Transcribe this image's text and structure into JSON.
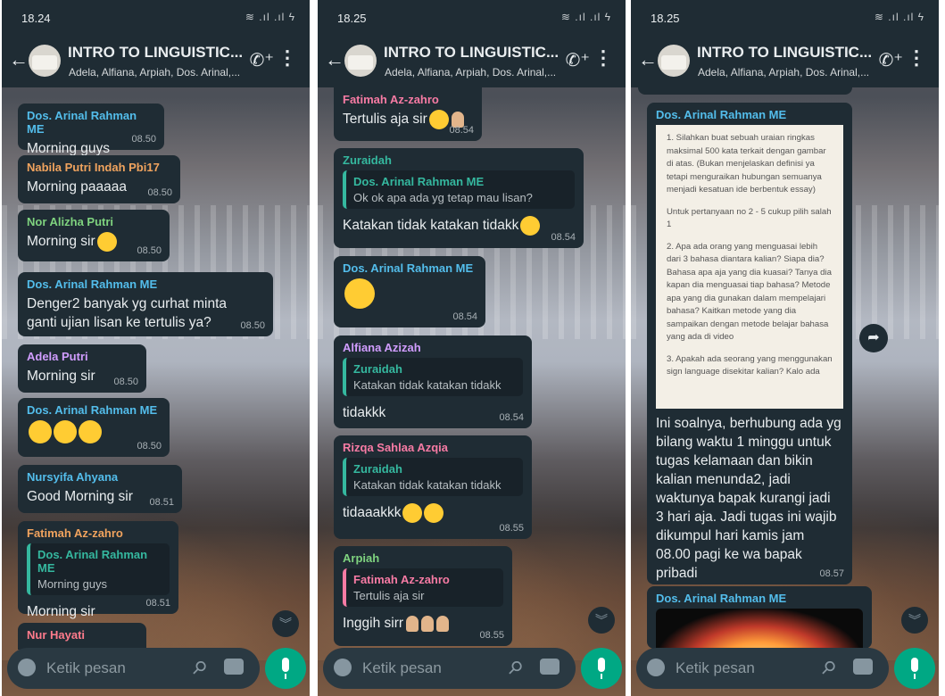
{
  "chat": {
    "title": "INTRO TO LINGUISTIC...",
    "members": "Adela, Alfiana, Arpiah, Dos. Arinal,...",
    "input_placeholder": "Ketik pesan"
  },
  "colors": {
    "header_bg": "#1f2c34",
    "bubble_bg": "#1f2c34",
    "accent": "#00a884"
  },
  "icons": [
    "back-arrow-icon",
    "group-avatar",
    "add-call-icon",
    "more-vert-icon",
    "emoji-icon",
    "attach-icon",
    "camera-icon",
    "mic-icon",
    "scroll-down-icon",
    "forward-icon"
  ],
  "screens": [
    {
      "status_time": "18.24",
      "messages": [
        {
          "sender": "Dos. Arinal Rahman ME",
          "text": "Morning guys",
          "time": "08.50"
        },
        {
          "sender": "Nabila Putri Indah Pbi17",
          "text": "Morning paaaaa",
          "time": "08.50"
        },
        {
          "sender": "Nor Alizha Putri",
          "text": "Morning sir",
          "time": "08.50"
        },
        {
          "sender": "Dos. Arinal Rahman ME",
          "text": "Denger2 banyak yg curhat minta ganti ujian lisan ke tertulis ya?",
          "time": "08.50"
        },
        {
          "sender": "Adela Putri",
          "text": "Morning sir",
          "time": "08.50"
        },
        {
          "sender": "Dos. Arinal Rahman ME",
          "text": "",
          "time": "08.50"
        },
        {
          "sender": "Nursyifa Ahyana",
          "text": "Good Morning sir",
          "time": "08.51"
        },
        {
          "sender": "Fatimah Az-zahro",
          "quote_sender": "Dos. Arinal Rahman ME",
          "quote_text": "Morning guys",
          "text": "Morning sir",
          "time": "08.51"
        },
        {
          "sender": "Nur Hayati",
          "text": "",
          "time": ""
        }
      ]
    },
    {
      "status_time": "18.25",
      "messages": [
        {
          "sender": "Fatimah Az-zahro",
          "text": "Tertulis aja sir",
          "time": "08.54"
        },
        {
          "sender": "Zuraidah",
          "quote_sender": "Dos. Arinal Rahman ME",
          "quote_text": "Ok ok apa ada yg tetap mau lisan?",
          "text": "Katakan tidak katakan tidakk",
          "time": "08.54"
        },
        {
          "sender": "Dos. Arinal Rahman ME",
          "text": "",
          "time": "08.54"
        },
        {
          "sender": "Alfiana Azizah",
          "quote_sender": "Zuraidah",
          "quote_text": "Katakan tidak katakan tidakk",
          "text": "tidakkk",
          "time": "08.54"
        },
        {
          "sender": "Rizqa Sahlaa Azqia",
          "quote_sender": "Zuraidah",
          "quote_text": "Katakan tidak katakan tidakk",
          "text": "tidaaakkk",
          "time": "08.55"
        },
        {
          "sender": "Arpiah",
          "quote_sender": "Fatimah Az-zahro",
          "quote_text": "Tertulis aja sir",
          "text": "Inggih sirr",
          "time": "08.55"
        }
      ]
    },
    {
      "status_time": "18.25",
      "messages": [
        {
          "sender": "Dos. Arinal Rahman ME",
          "doc_paragraphs": [
            "1. Silahkan buat sebuah uraian ringkas maksimal 500 kata terkait dengan gambar di atas. (Bukan menjelaskan definisi ya tetapi menguraikan hubungan semuanya menjadi kesatuan ide berbentuk essay)",
            "Untuk pertanyaan no 2 - 5 cukup pilih salah 1",
            "2. Apa ada orang yang menguasai lebih dari 3 bahasa diantara kalian? Siapa dia? Bahasa apa aja yang dia kuasai? Tanya dia kapan dia menguasai tiap bahasa? Metode apa yang dia gunakan dalam mempelajari bahasa? Kaitkan metode yang dia sampaikan dengan metode belajar bahasa yang ada di video",
            "3. Apakah ada seorang yang menggunakan sign language disekitar kalian? Kalo ada"
          ],
          "text": "Ini soalnya, berhubung ada yg bilang waktu 1 minggu untuk tugas kelamaan dan bikin kalian menunda2, jadi waktunya bapak kurangi jadi 3 hari aja. Jadi tugas ini wajib dikumpul hari kamis jam 08.00 pagi ke wa bapak pribadi",
          "time": "08.57"
        },
        {
          "sender": "Dos. Arinal Rahman ME",
          "text": "",
          "time": ""
        }
      ]
    }
  ]
}
